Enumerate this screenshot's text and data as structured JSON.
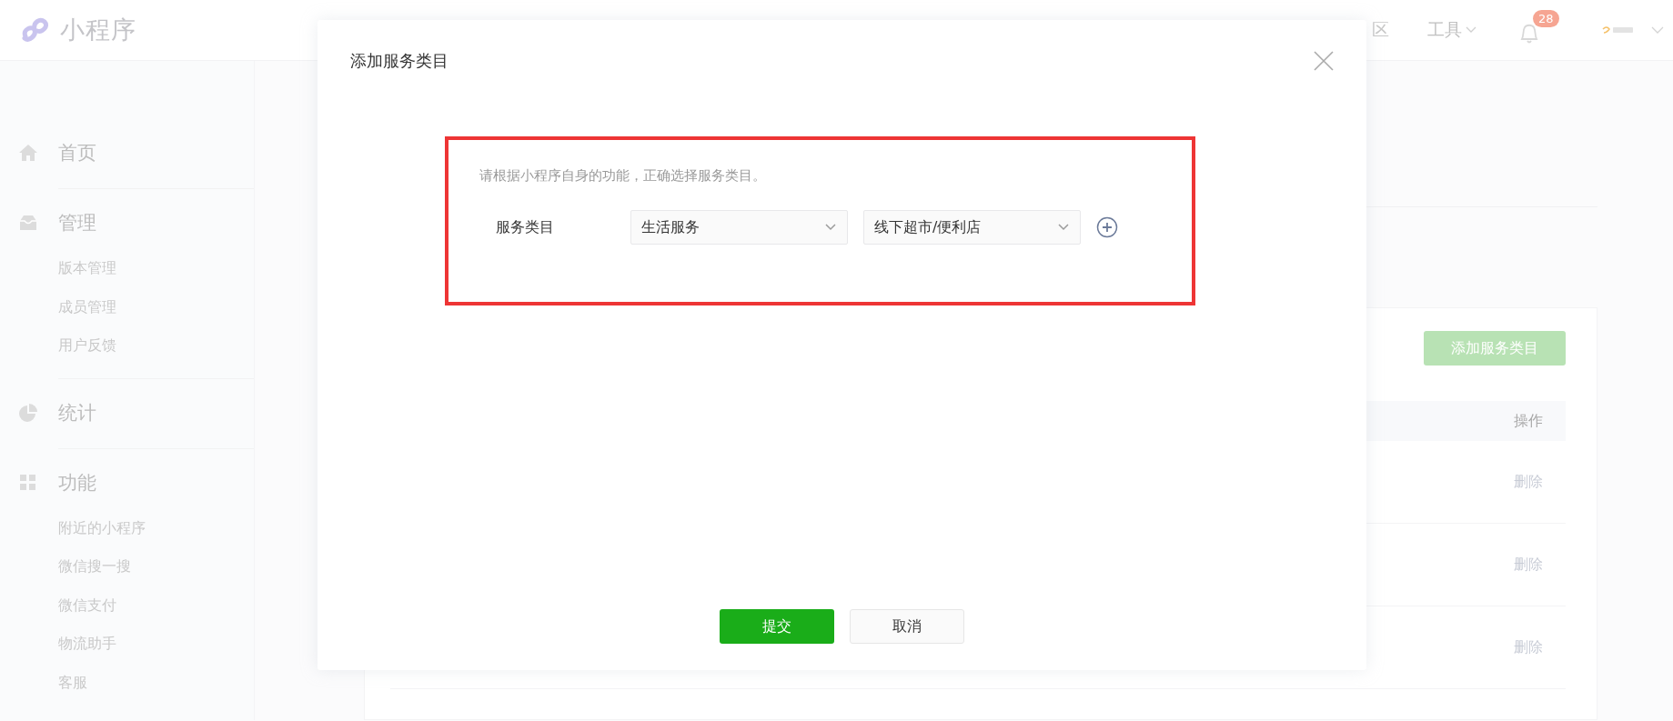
{
  "header": {
    "logo_text": "小程序",
    "partial_link": "区",
    "tools_menu": "工具",
    "notifications": {
      "badge": "28"
    }
  },
  "sidebar": {
    "sections": [
      {
        "label": "首页"
      },
      {
        "label": "管理",
        "children": [
          {
            "label": "版本管理"
          },
          {
            "label": "成员管理"
          },
          {
            "label": "用户反馈"
          }
        ]
      },
      {
        "label": "统计"
      },
      {
        "label": "功能",
        "children": [
          {
            "label": "附近的小程序"
          },
          {
            "label": "微信搜一搜"
          },
          {
            "label": "微信支付"
          },
          {
            "label": "物流助手"
          },
          {
            "label": "客服"
          }
        ]
      }
    ]
  },
  "page": {
    "add_button": "添加服务类目",
    "table": {
      "columns": [
        {
          "label": "操作"
        }
      ],
      "rows": [
        {
          "action": "删除"
        },
        {
          "action": "删除"
        },
        {
          "action": "删除"
        }
      ]
    }
  },
  "dialog": {
    "title": "添加服务类目",
    "hint": "请根据小程序自身的功能，正确选择服务类目。",
    "field_label": "服务类目",
    "selects": [
      {
        "value": "生活服务"
      },
      {
        "value": "线下超市/便利店"
      }
    ],
    "buttons": [
      {
        "label": "提交",
        "kind": "primary"
      },
      {
        "label": "取消",
        "kind": "default"
      }
    ]
  }
}
